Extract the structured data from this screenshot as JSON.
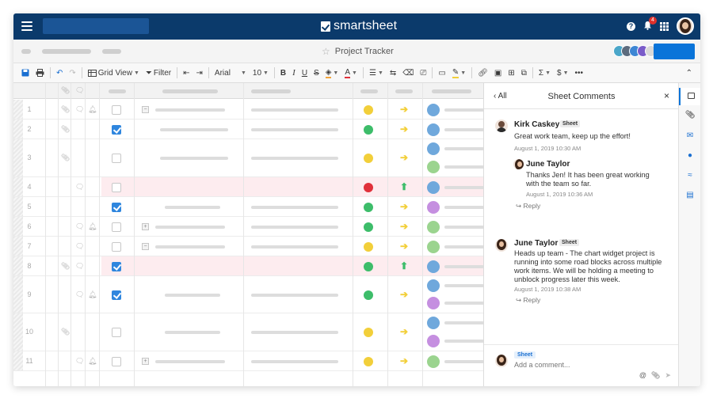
{
  "topbar": {
    "brand": "smartsheet",
    "notification_count": "4",
    "help_label": "?"
  },
  "subbar": {
    "sheet_title": "Project Tracker"
  },
  "toolbar": {
    "grid_view": "Grid View",
    "filter": "Filter",
    "font": "Arial",
    "font_size": "10",
    "bold": "B",
    "italic": "I",
    "underline": "U",
    "strike": "S",
    "color_a": "A",
    "sum": "Σ",
    "currency": "$",
    "more": "•••"
  },
  "grid": {
    "rows": [
      {
        "num": "1",
        "checked": false,
        "status": "#f2cf3a",
        "arrow": "right",
        "highlight": false
      },
      {
        "num": "2",
        "checked": true,
        "status": "#3dbd6a",
        "arrow": "right",
        "highlight": false
      },
      {
        "num": "3",
        "checked": false,
        "status": "#f2cf3a",
        "arrow": "right",
        "highlight": false
      },
      {
        "num": "4",
        "checked": false,
        "status": "#e0313b",
        "arrow": "up",
        "highlight": true
      },
      {
        "num": "5",
        "checked": true,
        "status": "#3dbd6a",
        "arrow": "right",
        "highlight": false
      },
      {
        "num": "6",
        "checked": false,
        "status": "#3dbd6a",
        "arrow": "right",
        "highlight": false
      },
      {
        "num": "7",
        "checked": false,
        "status": "#f2cf3a",
        "arrow": "right",
        "highlight": false
      },
      {
        "num": "8",
        "checked": true,
        "status": "#3dbd6a",
        "arrow": "up",
        "highlight": true
      },
      {
        "num": "9",
        "checked": true,
        "status": "#3dbd6a",
        "arrow": "right",
        "highlight": false
      },
      {
        "num": "10",
        "checked": false,
        "status": "#f2cf3a",
        "arrow": "right",
        "highlight": false
      },
      {
        "num": "11",
        "checked": false,
        "status": "#f2cf3a",
        "arrow": "right",
        "highlight": false
      }
    ]
  },
  "panel": {
    "back_label": "All",
    "title": "Sheet Comments",
    "close": "×",
    "comments": [
      {
        "name": "Kirk Caskey",
        "tag": "Sheet",
        "text": "Great work team, keep up the effort!",
        "date": "August 1, 2019 10:30 AM",
        "reply": {
          "name": "June Taylor",
          "text": "Thanks Jen! It has been great working with the team so far.",
          "date": "August 1, 2019 10:36 AM"
        },
        "reply_label": "Reply"
      },
      {
        "name": "June Taylor",
        "tag": "Sheet",
        "text": "Heads up team - The chart widget project is running into some road blocks across multiple work items. We will be holding a meeting to unblock progress later this week.",
        "date": "August 1, 2019 10:38 AM",
        "reply_label": "Reply"
      }
    ],
    "composer": {
      "tag": "Sheet",
      "placeholder": "Add a comment..."
    }
  },
  "colors": {
    "topbar": "#0b3a6b",
    "accent": "#0a74d9",
    "row_highlight": "#fdecef"
  }
}
